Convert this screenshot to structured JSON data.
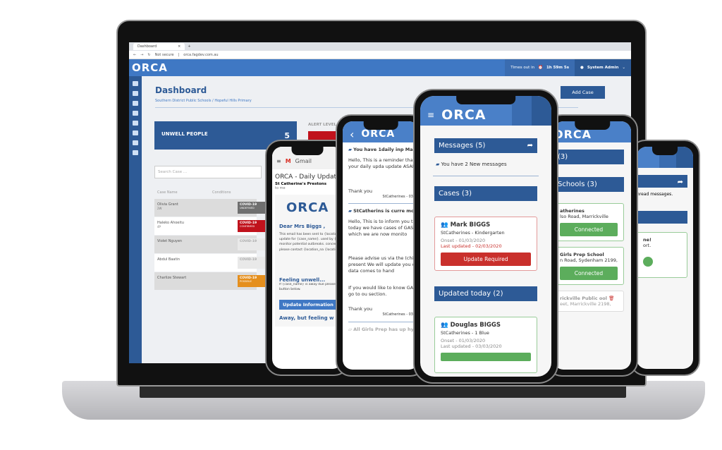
{
  "browser": {
    "tab_title": "Dashboard",
    "close": "×",
    "new_tab": "+",
    "not_secure": "Not secure",
    "url": "orca.fagdev.com.au"
  },
  "app": {
    "logo": "ORCA",
    "timeout_label": "Times out in",
    "timeout_value": "1h 59m 5s",
    "user": "System Admin"
  },
  "dashboard": {
    "title": "Dashboard",
    "breadcrumb": "Southern District Public Schools / Hopeful Hills Primary",
    "add_case": "Add Case",
    "unwell_label": "UNWELL PEOPLE",
    "unwell_count": "5",
    "alert_label": "ALERT LEVEL",
    "search_placeholder": "Search Case ...",
    "col_name": "Case Name",
    "col_conditions": "Conditions",
    "rows": [
      {
        "name": "Olivia Grant",
        "class": "2W",
        "badge": "COVID-19",
        "status": "UNDEFINED",
        "color": "#6f6f6f"
      },
      {
        "name": "Haleko Ahoeitu",
        "class": "4P",
        "badge": "COVID-19",
        "status": "CONFIRMED",
        "color": "#c0121c"
      },
      {
        "name": "Violet Nguyen",
        "class": "",
        "badge": "COVID-19",
        "status": "",
        "color": "#e9e9e9"
      },
      {
        "name": "Abdul Baatin",
        "class": "",
        "badge": "COVID-19",
        "status": "",
        "color": "#e9e9e9"
      },
      {
        "name": "Charlize Stewart",
        "class": "",
        "badge": "COVID-19",
        "status": "POSSIBLE",
        "color": "#e58f1d"
      }
    ]
  },
  "gmail": {
    "app": "Gmail",
    "subject": "ORCA - Daily Update",
    "sender": "St Catherine's Prestons",
    "to": "to me",
    "greeting": "Dear Mrs Biggs ,",
    "body": "This email has been sent to {location_name} to request update for {case_name}. used by {location_name} to monitor potential outbreaks. concerns about the authenti please contact {location_na {location_phone}.",
    "feeling": "Feeling unwell...",
    "feeling_body": "If {case_name} is away due please update the information button below.",
    "update_btn": "Update Information",
    "away": "Away, but feeling w"
  },
  "messages_phone": {
    "m1_title": "You have 1daily inp Mark BIGGS.",
    "m1_body": "Hello, This is a reminder that w received your daily upda update ASAP.",
    "m1_thanks": "Thank you",
    "m1_sig": "StCatherines - 03",
    "m2_title": "StCatherins is curre monitoring for GAS",
    "m2_body": "Hello, This is to inform you that 10:28AM today we have cases of GASTRO with in which we are now monito",
    "m2_body2": "Please advise us via the (child) starts to present We will update you on th more data comes to hand",
    "m2_body3": "If you would like to know GASTRO please go to ou section.",
    "m2_thanks": "Thank you",
    "m2_sig": "StCatherines - 03",
    "m3_title": "All Girls Prep has up hygiene process, let"
  },
  "main_phone": {
    "messages": "Messages (5)",
    "new_messages": "You have 2 New messages",
    "cases": "Cases (3)",
    "case1": {
      "name": "Mark BIGGS",
      "school": "StCatherines - Kindergarten",
      "onset": "Onset - 01/03/2020",
      "updated": "Last updated - 02/03/2020",
      "button": "Update Required"
    },
    "updated_today": "Updated today (2)",
    "case2": {
      "name": "Douglas BIGGS",
      "school": "StCatherines - 1 Blue",
      "onset": "Onset - 01/03/2020",
      "updated": "Last updated - 03/03/2020"
    }
  },
  "schools_phone": {
    "header_partial": "(3)",
    "schools": "Schools (3)",
    "s1": {
      "name": "atherines",
      "address": "lso Road, Marrickville",
      "btn": "Connected"
    },
    "s2": {
      "name": "Girls Prep School",
      "address": "n Road, Sydenham 2199,",
      "btn": "Connected"
    },
    "s3": {
      "name": "rickville Public ool",
      "address": "eet, Marrickville 2198,"
    }
  },
  "back_phone": {
    "unread": "nread messages.",
    "card_title": "ne!",
    "card_body": "ort."
  },
  "colors": {
    "brand": "#3f78c4",
    "navy": "#2d5a96",
    "danger": "#c9302c",
    "success": "#5cad5c"
  }
}
